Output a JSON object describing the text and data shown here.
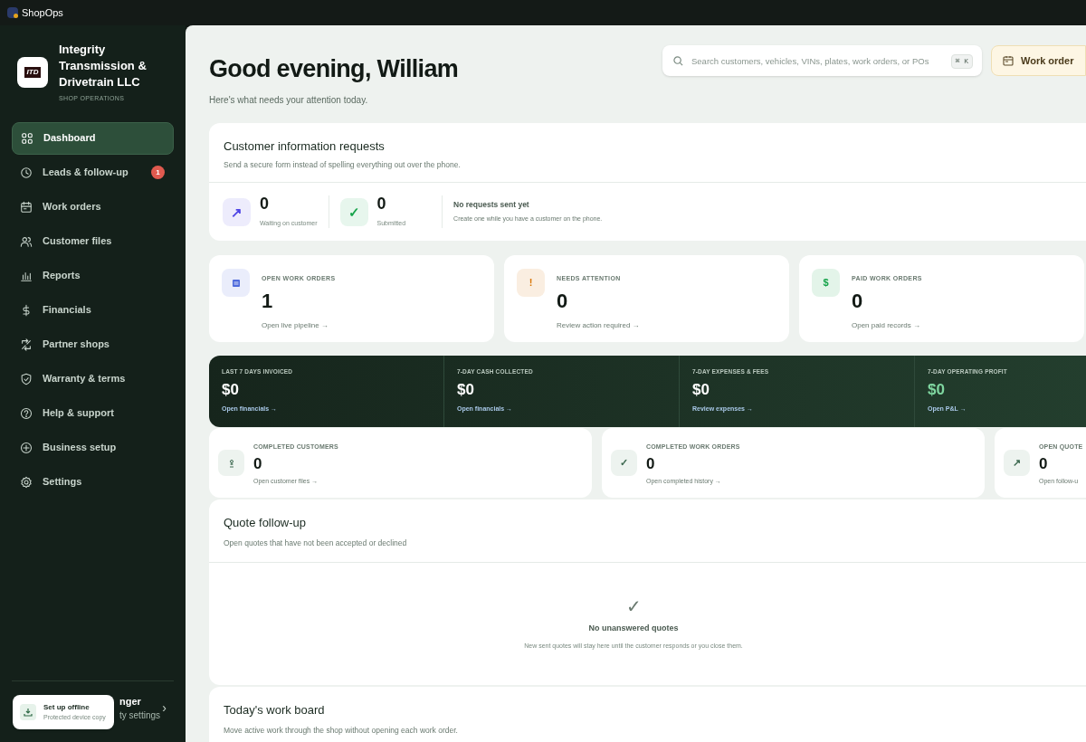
{
  "app": {
    "title": "ShopOps"
  },
  "sidebar": {
    "company_name": "Integrity Transmission & Drivetrain LLC",
    "company_subtitle": "SHOP OPERATIONS",
    "logo_text": "ITD",
    "items": [
      {
        "label": "Dashboard",
        "selected": true
      },
      {
        "label": "Leads & follow-up",
        "selected": false,
        "badge": "1"
      },
      {
        "label": "Work orders",
        "selected": false
      },
      {
        "label": "Customer files",
        "selected": false
      },
      {
        "label": "Reports",
        "selected": false
      },
      {
        "label": "Financials",
        "selected": false
      },
      {
        "label": "Partner shops",
        "selected": false
      },
      {
        "label": "Warranty & terms",
        "selected": false
      },
      {
        "label": "Help & support",
        "selected": false
      },
      {
        "label": "Business setup",
        "selected": false
      },
      {
        "label": "Settings",
        "selected": false
      }
    ]
  },
  "user_card": {
    "name": "nger",
    "detail": "ty settings",
    "chevron": "›"
  },
  "offline_toast": {
    "title": "Set up offline",
    "subtitle": "Protected device copy"
  },
  "header": {
    "greeting": "Good evening, William",
    "subtitle": "Here's what needs your attention today."
  },
  "search": {
    "placeholder": "Search customers, vehicles, VINs, plates, work orders, or POs",
    "shortcut": "⌘ K"
  },
  "work_order_button": {
    "label": "Work order"
  },
  "requests_card": {
    "title": "Customer information requests",
    "subtitle": "Send a secure form instead of spelling everything out over the phone.",
    "stats": [
      {
        "icon": "↗",
        "value": "0",
        "label": "Waiting on customer",
        "color": "#4f46e5"
      },
      {
        "icon": "✓",
        "value": "0",
        "label": "Submitted",
        "color": "#16a34a"
      }
    ],
    "empty_title": "No requests sent yet",
    "empty_text": "Create one while you have a customer on the phone."
  },
  "summary_cards": [
    {
      "label": "OPEN WORK ORDERS",
      "value": "1",
      "link": "Open live pipeline →",
      "color": "#4f6bdc"
    },
    {
      "label": "NEEDS ATTENTION",
      "value": "0",
      "link": "Review action required →",
      "icon": "!",
      "color": "#d97706"
    },
    {
      "label": "PAID WORK ORDERS",
      "value": "0",
      "link": "Open paid records →",
      "icon": "$",
      "color": "#16a34a"
    }
  ],
  "financials": [
    {
      "label": "LAST 7 DAYS INVOICED",
      "value": "$0",
      "link": "Open financials →",
      "accent": false
    },
    {
      "label": "7-DAY CASH COLLECTED",
      "value": "$0",
      "link": "Open financials →",
      "accent": false
    },
    {
      "label": "7-DAY EXPENSES & FEES",
      "value": "$0",
      "link": "Review expenses →",
      "accent": false
    },
    {
      "label": "7-DAY OPERATING PROFIT",
      "value": "$0",
      "link": "Open P&L →",
      "accent": true
    }
  ],
  "completed": [
    {
      "label": "COMPLETED CUSTOMERS",
      "value": "0",
      "link": "Open customer files →"
    },
    {
      "label": "COMPLETED WORK ORDERS",
      "value": "0",
      "link": "Open completed history →",
      "icon": "✓"
    },
    {
      "label": "OPEN QUOTE",
      "value": "0",
      "link": "Open follow-u",
      "icon": "↗"
    }
  ],
  "quote_followup": {
    "title": "Quote follow-up",
    "subtitle": "Open quotes that have not been accepted or declined",
    "empty_mark": "✓",
    "empty_title": "No unanswered quotes",
    "empty_text": "New sent quotes will stay here until the customer responds or you close them."
  },
  "work_board": {
    "title": "Today's work board",
    "subtitle": "Move active work through the shop without opening each work order."
  }
}
